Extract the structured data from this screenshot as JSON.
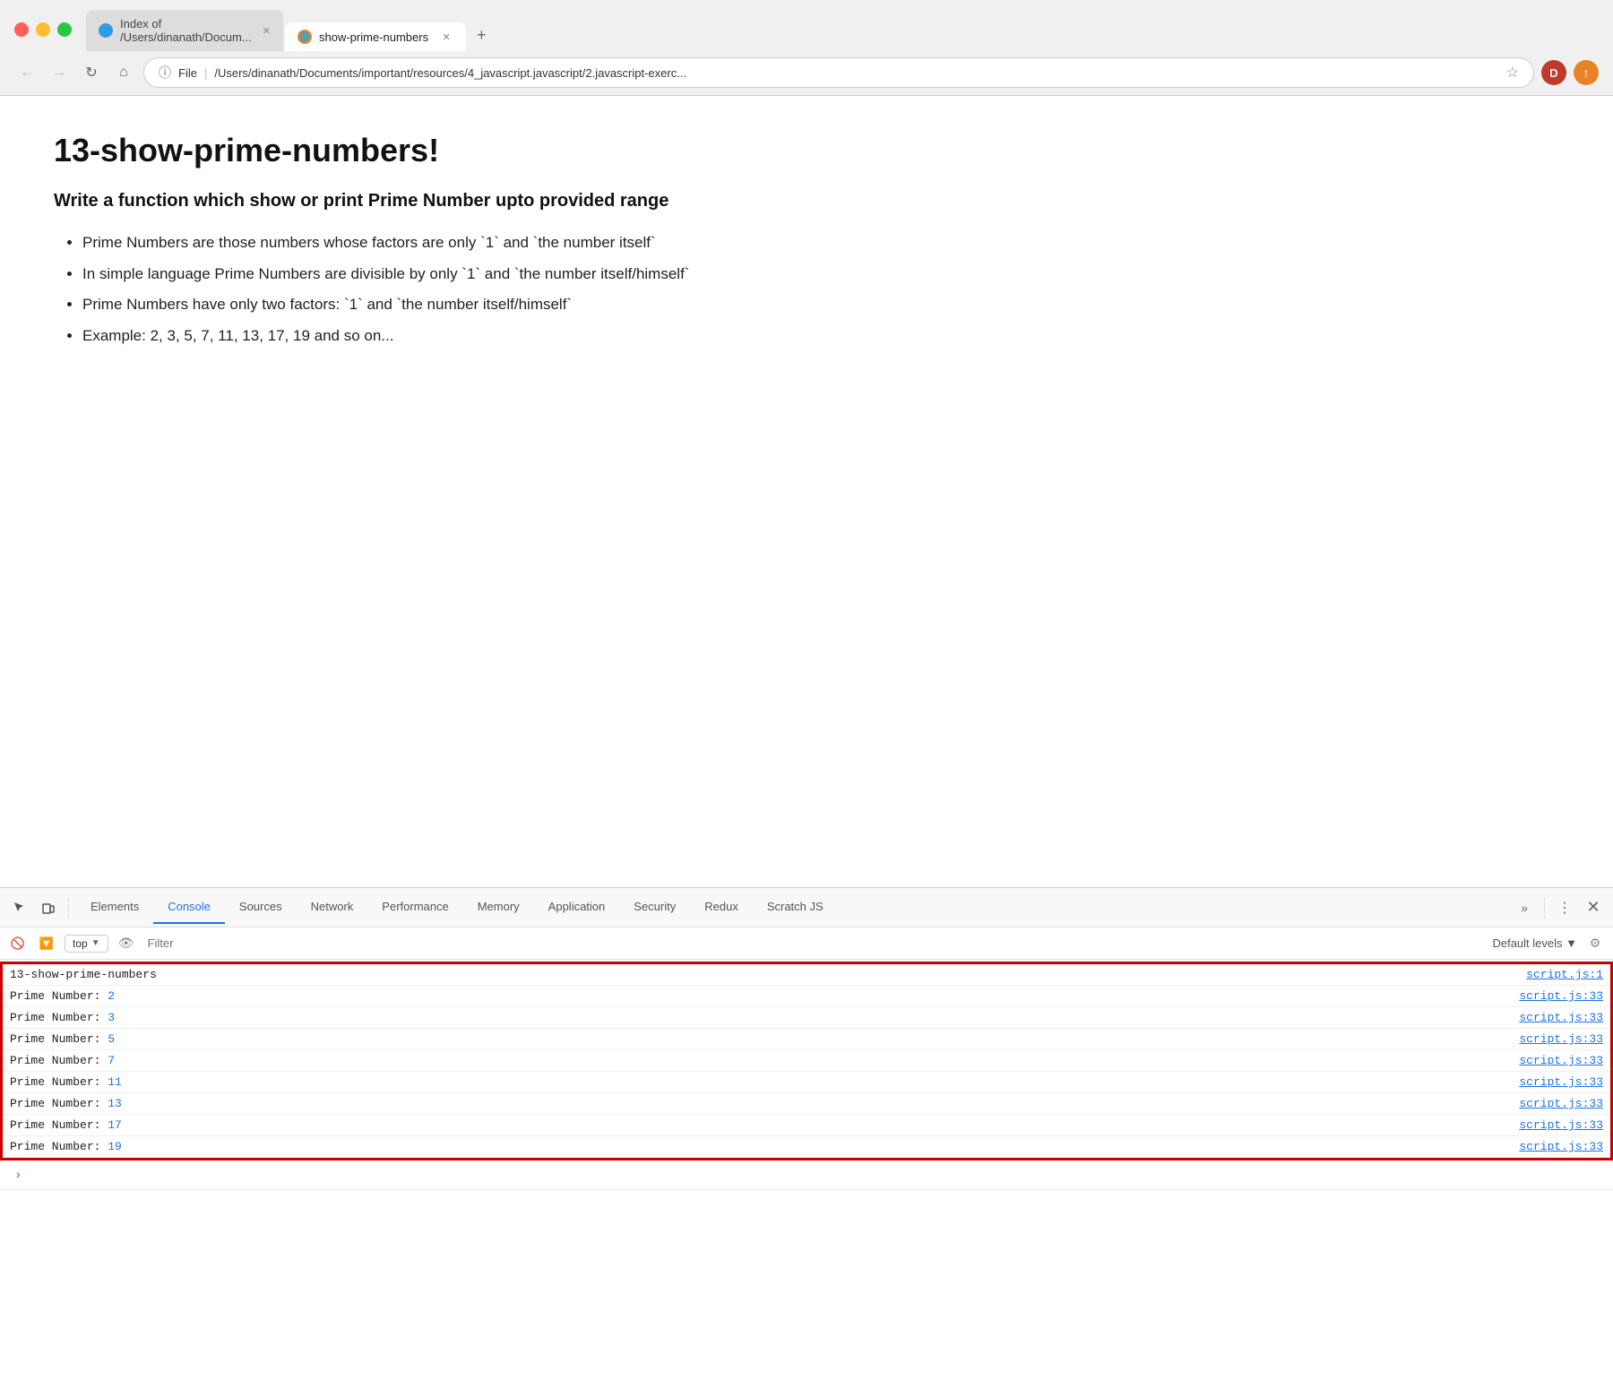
{
  "browser": {
    "tabs": [
      {
        "id": "tab1",
        "title": "Index of /Users/dinanath/Docum...",
        "icon": "globe",
        "active": false
      },
      {
        "id": "tab2",
        "title": "show-prime-numbers",
        "icon": "globe-orange",
        "active": true
      }
    ],
    "new_tab_label": "+",
    "address": "/Users/dinanath/Documents/important/resources/4_javascript.javascript/2.javascript-exerc...",
    "address_protocol": "File",
    "profile_initial": "D",
    "back_btn": "←",
    "forward_btn": "→",
    "reload_btn": "↻",
    "home_btn": "⌂"
  },
  "page": {
    "title": "13-show-prime-numbers!",
    "subtitle": "Write a function which show or print Prime Number upto provided range",
    "bullets": [
      "Prime Numbers are those numbers whose factors are only `1` and `the number itself`",
      "In simple language Prime Numbers are divisible by only `1` and `the number itself/himself`",
      "Prime Numbers have only two factors: `1` and `the number itself/himself`",
      "Example: 2, 3, 5, 7, 11, 13, 17, 19 and so on..."
    ]
  },
  "devtools": {
    "tabs": [
      {
        "id": "elements",
        "label": "Elements",
        "active": false
      },
      {
        "id": "console",
        "label": "Console",
        "active": true
      },
      {
        "id": "sources",
        "label": "Sources",
        "active": false
      },
      {
        "id": "network",
        "label": "Network",
        "active": false
      },
      {
        "id": "performance",
        "label": "Performance",
        "active": false
      },
      {
        "id": "memory",
        "label": "Memory",
        "active": false
      },
      {
        "id": "application",
        "label": "Application",
        "active": false
      },
      {
        "id": "security",
        "label": "Security",
        "active": false
      },
      {
        "id": "redux",
        "label": "Redux",
        "active": false
      },
      {
        "id": "scratchjs",
        "label": "Scratch JS",
        "active": false
      }
    ],
    "more_label": "»",
    "context": "top",
    "filter_placeholder": "Filter",
    "default_levels": "Default levels ▼",
    "console_rows": [
      {
        "id": "row1",
        "text": "13-show-prime-numbers",
        "number": null,
        "link": "script.js:1",
        "highlighted": true
      },
      {
        "id": "row2",
        "text": "Prime Number: ",
        "number": "2",
        "link": "script.js:33",
        "highlighted": true
      },
      {
        "id": "row3",
        "text": "Prime Number: ",
        "number": "3",
        "link": "script.js:33",
        "highlighted": true
      },
      {
        "id": "row4",
        "text": "Prime Number: ",
        "number": "5",
        "link": "script.js:33",
        "highlighted": true
      },
      {
        "id": "row5",
        "text": "Prime Number: ",
        "number": "7",
        "link": "script.js:33",
        "highlighted": true
      },
      {
        "id": "row6",
        "text": "Prime Number: ",
        "number": "11",
        "link": "script.js:33",
        "highlighted": true
      },
      {
        "id": "row7",
        "text": "Prime Number: ",
        "number": "13",
        "link": "script.js:33",
        "highlighted": true
      },
      {
        "id": "row8",
        "text": "Prime Number: ",
        "number": "17",
        "link": "script.js:33",
        "highlighted": true
      },
      {
        "id": "row9",
        "text": "Prime Number: ",
        "number": "19",
        "link": "script.js:33",
        "highlighted": true
      }
    ]
  }
}
